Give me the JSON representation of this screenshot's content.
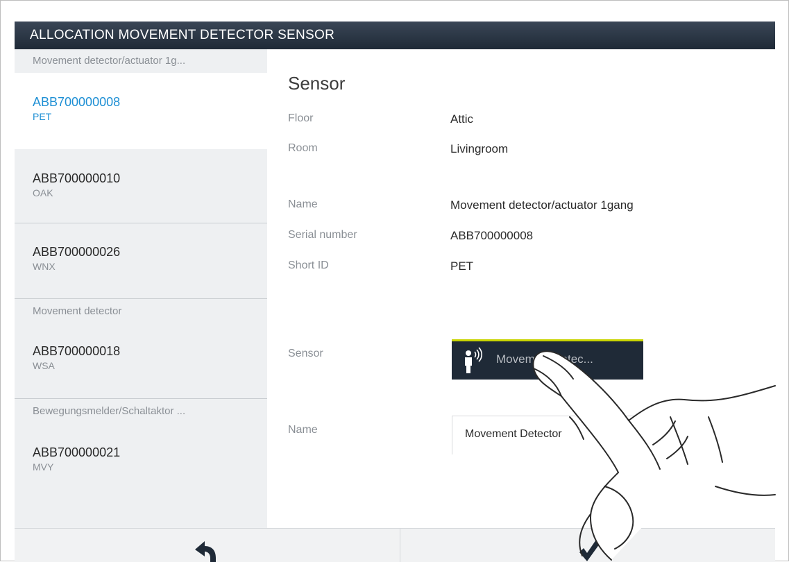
{
  "window": {
    "title": "ALLOCATION MOVEMENT DETECTOR SENSOR"
  },
  "sidebar": {
    "groups": [
      {
        "header": "Movement detector/actuator 1g..."
      },
      {
        "header": "Movement detector"
      },
      {
        "header": "Bewegungsmelder/Schaltaktor ..."
      }
    ],
    "items": [
      {
        "serial": "ABB700000008",
        "short_id": "PET",
        "selected": true
      },
      {
        "serial": "ABB700000010",
        "short_id": "OAK"
      },
      {
        "serial": "ABB700000026",
        "short_id": "WNX"
      },
      {
        "serial": "ABB700000018",
        "short_id": "WSA"
      },
      {
        "serial": "ABB700000021",
        "short_id": "MVY"
      }
    ]
  },
  "detail": {
    "heading": "Sensor",
    "floor_label": "Floor",
    "floor_value": "Attic",
    "room_label": "Room",
    "room_value": "Livingroom",
    "name_label": "Name",
    "name_value": "Movement detector/actuator 1gang",
    "serial_label": "Serial number",
    "serial_value": "ABB700000008",
    "shortid_label": "Short ID",
    "shortid_value": "PET",
    "sensor_label": "Sensor",
    "sensor_button": "Movement detec...",
    "name2_label": "Name",
    "name2_value": "Movement Detector"
  },
  "colors": {
    "titlebar": "#1f2a37",
    "accent": "#1e8fd4",
    "button_highlight": "#c8d400"
  },
  "icons": {
    "back": "back-arrow-icon",
    "confirm": "checkmark-icon",
    "sensor": "movement-sensor-icon"
  }
}
